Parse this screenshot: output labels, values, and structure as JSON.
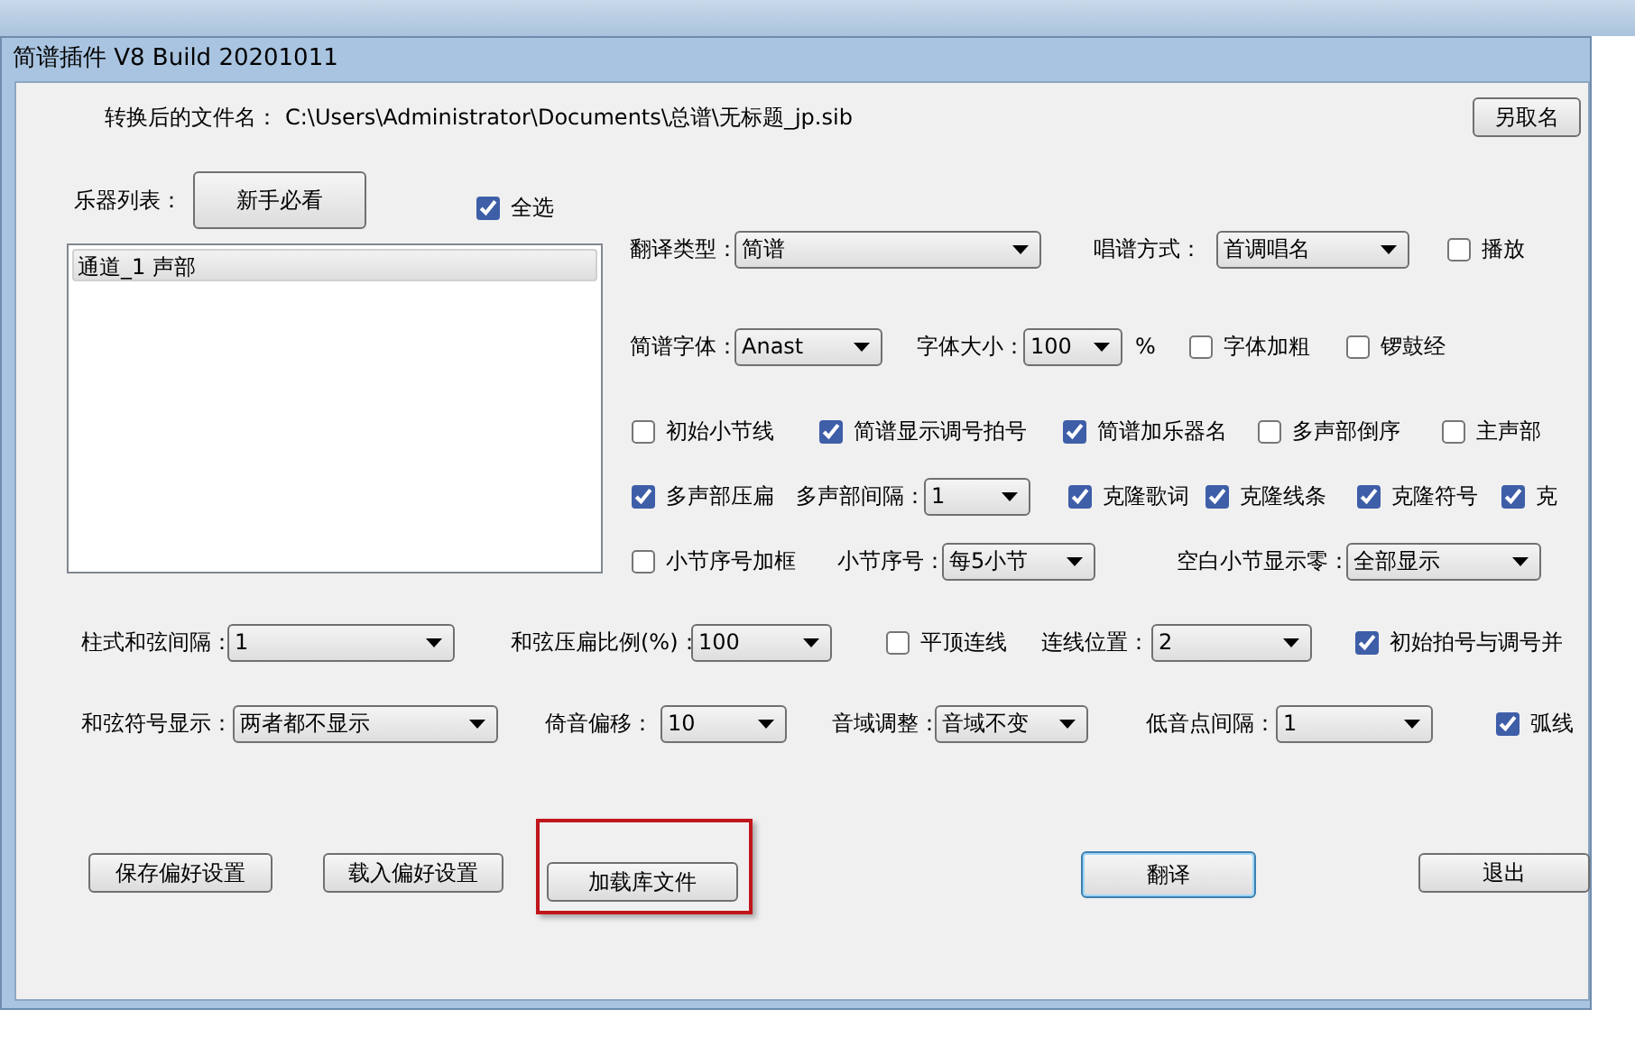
{
  "window": {
    "title": "简谱插件 V8   Build 20201011"
  },
  "output_file": {
    "label": "转换后的文件名：",
    "path": "C:\\Users\\Administrator\\Documents\\总谱\\无标题_jp.sib",
    "button": "另取名"
  },
  "instruments": {
    "label": "乐器列表：",
    "guide_button": "新手必看",
    "select_all": {
      "label": "全选",
      "checked": true
    },
    "items": [
      {
        "label": "通道_1 声部",
        "selected": true
      }
    ]
  },
  "options": [
    [
      {
        "kind": "label",
        "text": "翻译类型："
      },
      {
        "kind": "select",
        "value": "简谱"
      },
      {
        "kind": "label",
        "text": "唱谱方式："
      },
      {
        "kind": "select",
        "value": "首调唱名"
      },
      {
        "kind": "checkbox",
        "label": "播放",
        "checked": false
      }
    ],
    [
      {
        "kind": "label",
        "text": "简谱字体："
      },
      {
        "kind": "select",
        "value": "Anast"
      },
      {
        "kind": "label",
        "text": "字体大小："
      },
      {
        "kind": "select",
        "value": "100"
      },
      {
        "kind": "label",
        "text": "%"
      },
      {
        "kind": "checkbox",
        "label": "字体加粗",
        "checked": false
      },
      {
        "kind": "checkbox",
        "label": "锣鼓经",
        "checked": false
      }
    ],
    [
      {
        "kind": "checkbox",
        "label": "初始小节线",
        "checked": false
      },
      {
        "kind": "checkbox",
        "label": "简谱显示调号拍号",
        "checked": true
      },
      {
        "kind": "checkbox",
        "label": "简谱加乐器名",
        "checked": true
      },
      {
        "kind": "checkbox",
        "label": "多声部倒序",
        "checked": false
      },
      {
        "kind": "checkbox",
        "label": "主声部",
        "checked": false
      }
    ],
    [
      {
        "kind": "checkbox",
        "label": "多声部压扁",
        "checked": true
      },
      {
        "kind": "label",
        "text": "多声部间隔："
      },
      {
        "kind": "select",
        "value": "1"
      },
      {
        "kind": "checkbox",
        "label": "克隆歌词",
        "checked": true
      },
      {
        "kind": "checkbox",
        "label": "克隆线条",
        "checked": true
      },
      {
        "kind": "checkbox",
        "label": "克隆符号",
        "checked": true
      },
      {
        "kind": "checkbox",
        "label": "克",
        "checked": true
      }
    ],
    [
      {
        "kind": "checkbox",
        "label": "小节序号加框",
        "checked": false
      },
      {
        "kind": "label",
        "text": "小节序号："
      },
      {
        "kind": "select",
        "value": "每5小节"
      },
      {
        "kind": "label",
        "text": "空白小节显示零："
      },
      {
        "kind": "select",
        "value": "全部显示"
      }
    ],
    [
      {
        "kind": "label",
        "text": "柱式和弦间隔："
      },
      {
        "kind": "select",
        "value": "1"
      },
      {
        "kind": "label",
        "text": "和弦压扁比例(%)："
      },
      {
        "kind": "select",
        "value": "100"
      },
      {
        "kind": "checkbox",
        "label": "平顶连线",
        "checked": false
      },
      {
        "kind": "label",
        "text": "连线位置："
      },
      {
        "kind": "select",
        "value": "2"
      },
      {
        "kind": "checkbox",
        "label": "初始拍号与调号并",
        "checked": true
      }
    ],
    [
      {
        "kind": "label",
        "text": "和弦符号显示："
      },
      {
        "kind": "select",
        "value": "两者都不显示"
      },
      {
        "kind": "label",
        "text": "倚音偏移："
      },
      {
        "kind": "select",
        "value": "10"
      },
      {
        "kind": "label",
        "text": "音域调整："
      },
      {
        "kind": "select",
        "value": "音域不变"
      },
      {
        "kind": "label",
        "text": "低音点间隔："
      },
      {
        "kind": "select",
        "value": "1"
      },
      {
        "kind": "checkbox",
        "label": "弧线",
        "checked": true
      }
    ]
  ],
  "buttons": [
    {
      "label": "保存偏好设置",
      "default": false,
      "highlighted": false
    },
    {
      "label": "载入偏好设置",
      "default": false,
      "highlighted": false
    },
    {
      "label": "加载库文件",
      "default": false,
      "highlighted": true
    },
    {
      "label": "翻译",
      "default": true,
      "highlighted": false
    },
    {
      "label": "退出",
      "default": false,
      "highlighted": false
    }
  ]
}
